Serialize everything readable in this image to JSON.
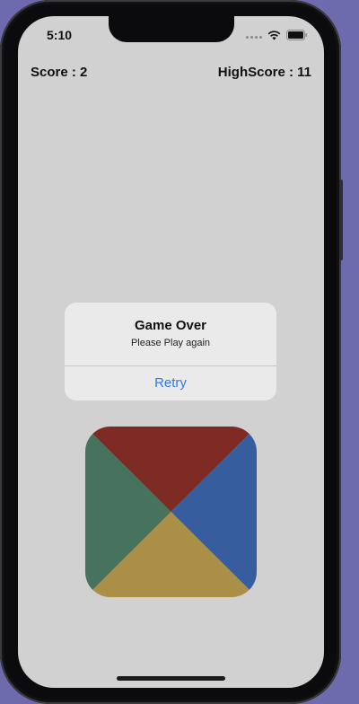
{
  "status_bar": {
    "time": "5:10",
    "icons": [
      "signal-dots-icon",
      "wifi-icon",
      "battery-icon"
    ]
  },
  "header": {
    "score": "Score : 2",
    "highscore": "HighScore : 11"
  },
  "alert": {
    "title": "Game Over",
    "message": "Please Play again",
    "button": "Retry"
  },
  "game_pad": {
    "segments": [
      {
        "name": "top",
        "color": "#7e2b24"
      },
      {
        "name": "right",
        "color": "#365e9e"
      },
      {
        "name": "bottom",
        "color": "#ab8f46"
      },
      {
        "name": "left",
        "color": "#47735e"
      }
    ]
  },
  "colors": {
    "background": "#6d6aad",
    "screen": "#d1d1d1",
    "alert_bg": "#eaeaea",
    "accent": "#2f7ae5"
  }
}
